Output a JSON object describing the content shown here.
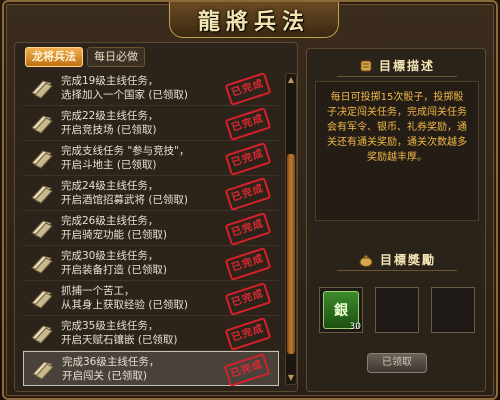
{
  "window": {
    "title": "龍將兵法",
    "close_label": "×"
  },
  "tabs": [
    {
      "label": "龙将兵法",
      "active": true
    },
    {
      "label": "每日必做",
      "active": false
    }
  ],
  "stamp_label": "已完成",
  "tasks": [
    {
      "text": "完成19级主线任务，\n选择加入一个国家 (已领取)",
      "done": true,
      "selected": false
    },
    {
      "text": "完成22级主线任务，\n开启竞技场 (已领取)",
      "done": true,
      "selected": false
    },
    {
      "text": "完成支线任务 \"参与竞技\"，\n开启斗地主 (已领取)",
      "done": true,
      "selected": false
    },
    {
      "text": "完成24级主线任务，\n开启酒馆招募武将 (已领取)",
      "done": true,
      "selected": false
    },
    {
      "text": "完成26级主线任务，\n开启骑宠功能 (已领取)",
      "done": true,
      "selected": false
    },
    {
      "text": "完成30级主线任务，\n开启装备打造 (已领取)",
      "done": true,
      "selected": false
    },
    {
      "text": "抓捕一个苦工，\n从其身上获取经验 (已领取)",
      "done": true,
      "selected": false
    },
    {
      "text": "完成35级主线任务，\n开启天赋石镶嵌 (已领取)",
      "done": true,
      "selected": false
    },
    {
      "text": "完成36级主线任务，\n开启闯关 (已领取)",
      "done": true,
      "selected": true
    }
  ],
  "scroll": {
    "up": "▲",
    "down": "▼"
  },
  "goal_section": {
    "title": "目標描述",
    "description": "每日可投掷15次骰子，投掷骰子决定闯关任务，完成闯关任务会有军令、银币、礼券奖励，通关还有通关奖励，通关次数越多奖励越丰厚。"
  },
  "reward_section": {
    "title": "目標獎勵",
    "items": [
      {
        "label": "銀",
        "count": "30"
      }
    ],
    "claim_label": "已领取"
  },
  "colors": {
    "accent": "#f0b050",
    "description_text": "#f0b848",
    "stamp_red": "#e02830"
  }
}
